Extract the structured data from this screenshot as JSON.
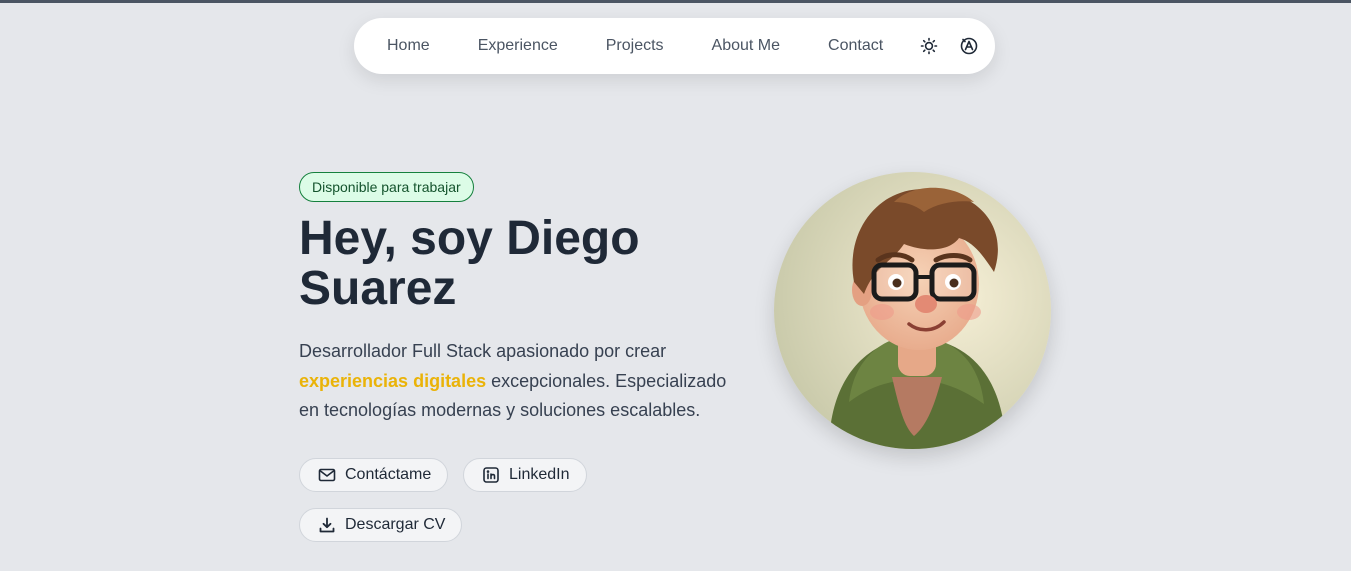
{
  "nav": {
    "links": [
      "Home",
      "Experience",
      "Projects",
      "About Me",
      "Contact"
    ],
    "theme_icon": "sun-icon",
    "language_icon": "translate-icon"
  },
  "hero": {
    "badge": "Disponible para trabajar",
    "title": "Hey, soy Diego Suarez",
    "description_before": "Desarrollador Full Stack apasionado por crear ",
    "description_highlight": "experiencias digitales",
    "description_after": " excepcionales. Especializado en tecnologías modernas y soluciones escalables.",
    "buttons": {
      "contact": "Contáctame",
      "linkedin": "LinkedIn",
      "cv": "Descargar CV"
    },
    "avatar_icon": "profile-avatar-illustration"
  },
  "colors": {
    "background": "#e5e7eb",
    "highlight": "#eab308",
    "badge_bg": "#dcfce7",
    "badge_border": "#15803d"
  }
}
